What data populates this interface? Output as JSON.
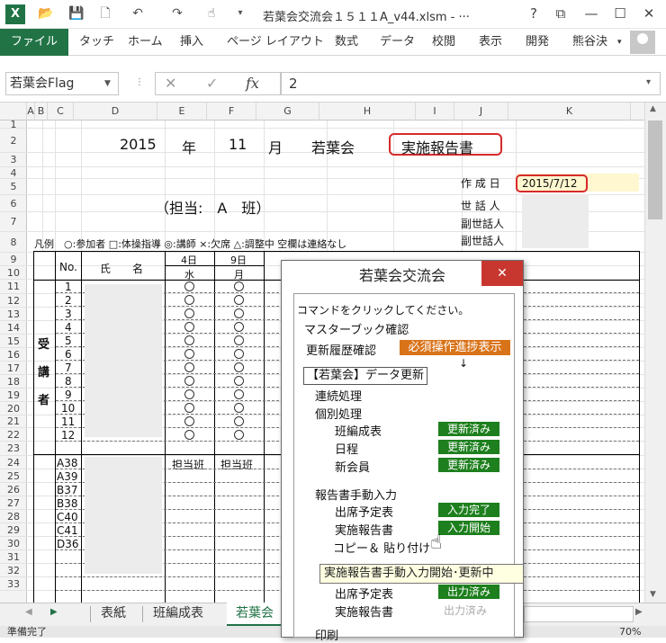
{
  "window": {
    "title": "若葉会交流会１５１１A_v44.xlsm - ···",
    "help": "?",
    "restore": "⧉",
    "minimize": "—",
    "maximize": "☐",
    "close": "✕"
  },
  "ribbon": {
    "file": "ファイル",
    "tabs": [
      "タッチ",
      "ホーム",
      "挿入",
      "ページ レイアウト",
      "数式",
      "データ",
      "校閲",
      "表示",
      "開発"
    ],
    "user": "熊谷決"
  },
  "formula_bar": {
    "name_box": "若葉会Flag",
    "fx": "fx",
    "value": "2"
  },
  "columns": [
    "A",
    "B",
    "C",
    "D",
    "E",
    "F",
    "G",
    "H",
    "I",
    "J",
    "K"
  ],
  "rows": [
    "1",
    "2",
    "3",
    "4",
    "5",
    "6",
    "7",
    "8",
    "9",
    "10",
    "11",
    "12",
    "13",
    "14",
    "15",
    "16",
    "17",
    "18",
    "19",
    "20",
    "21",
    "22",
    "23",
    "24",
    "25",
    "26",
    "27",
    "28",
    "29",
    "30",
    "31",
    "32",
    "33"
  ],
  "sheet": {
    "year": "2015",
    "year_unit": "年",
    "month": "11",
    "month_unit": "月",
    "org": "若葉会",
    "report_title": "実施報告書",
    "created_label": "作 成 日",
    "created_date": "2015/7/12",
    "tantou": "（担当:　A　班）",
    "sewanin": "世 話 人",
    "fuku1": "副世話人",
    "fuku2": "副世話人",
    "legend": "凡例　○:参加者 □:体操指導 ◎:講師 ×:欠席 △:調整中 空欄は連絡なし",
    "hdr_no": "No.",
    "hdr_name": "氏　　名",
    "hdr_day1": "4日",
    "hdr_wd1": "水",
    "hdr_day2": "9日",
    "hdr_wd2": "月",
    "side_label": [
      "受",
      "講",
      "者"
    ],
    "nums": [
      "1",
      "2",
      "3",
      "4",
      "5",
      "6",
      "7",
      "8",
      "9",
      "10",
      "11",
      "12"
    ],
    "group_label": "担当班",
    "codes": [
      "A38",
      "A39",
      "B37",
      "B38",
      "C40",
      "C41",
      "D36"
    ]
  },
  "dialog": {
    "title": "若葉会交流会",
    "close": "✕",
    "prompt": "コマンドをクリックしてください。",
    "master": "マスターブック確認",
    "history": "更新履歴確認",
    "must_btn": "必須操作進捗表示",
    "arrow": "↓",
    "data_update": "【若葉会】データ更新",
    "continuous": "連続処理",
    "individual": "個別処理",
    "item_hensei": "班編成表",
    "item_nittei": "日程",
    "item_shinkaiin": "新会員",
    "status_updated": "更新済み",
    "manual_input": "報告書手動入力",
    "item_shusseki": "出席予定表",
    "item_jisshi": "実施報告書",
    "item_copy": "コピー＆ 貼り付け",
    "status_input_done": "入力完了",
    "status_input_start": "入力開始",
    "item_shusseki2": "出席予定表",
    "item_jisshi2": "実施報告書",
    "status_output_done": "出力済み",
    "status_output_pending": "出力済み",
    "print": "印刷"
  },
  "tooltip": "実施報告書手動入力開始･更新中",
  "sheet_tabs": [
    "表紙",
    "班編成表",
    "若葉会"
  ],
  "status_bar": "準備完了",
  "zoom": "70%",
  "colors": {
    "excel_green": "#217346",
    "status_green": "#1d7f1d",
    "orange": "#d9731a",
    "red": "#d62a2a",
    "close_red": "#c7372f",
    "date_fill": "#fff7cf"
  }
}
